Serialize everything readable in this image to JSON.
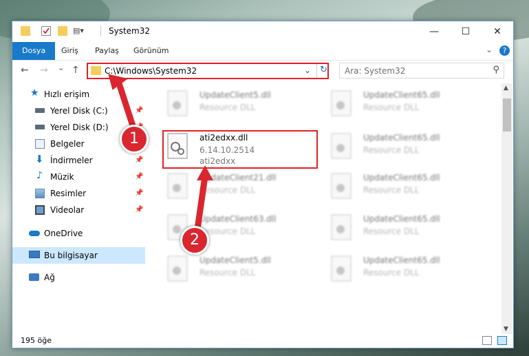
{
  "window": {
    "title": "System32",
    "controls": {
      "minimize": "—",
      "maximize": "☐",
      "close": "✕"
    }
  },
  "ribbon": {
    "tabs": [
      "Dosya",
      "Giriş",
      "Paylaş",
      "Görünüm"
    ],
    "active_tab": "Dosya",
    "expand_icon": "chevron-down-icon",
    "help_icon": "help-icon"
  },
  "navigation": {
    "back": "←",
    "forward": "→",
    "recent": "⌄",
    "up": "↑",
    "address": "C:\\Windows\\System32",
    "dropdown": "⌄",
    "refresh": "↻",
    "search_placeholder": "Ara: System32",
    "search_icon_glyph": "⚲"
  },
  "sidebar": {
    "items": [
      {
        "label": "Hızlı erişim",
        "icon": "star-icon",
        "pinned": false
      },
      {
        "label": "Yerel Disk (C:)",
        "icon": "drive-icon",
        "pinned": true
      },
      {
        "label": "Yerel Disk (D:)",
        "icon": "drive-icon",
        "pinned": true
      },
      {
        "label": "Belgeler",
        "icon": "documents-icon",
        "pinned": true
      },
      {
        "label": "İndirmeler",
        "icon": "download-icon",
        "pinned": true
      },
      {
        "label": "Müzik",
        "icon": "music-icon",
        "pinned": true
      },
      {
        "label": "Resimler",
        "icon": "pictures-icon",
        "pinned": true
      },
      {
        "label": "Videolar",
        "icon": "videos-icon",
        "pinned": true
      },
      {
        "label": "OneDrive",
        "icon": "cloud-icon",
        "pinned": false
      },
      {
        "label": "Bu bilgisayar",
        "icon": "computer-icon",
        "pinned": false,
        "selected": true
      },
      {
        "label": "Ağ",
        "icon": "network-icon",
        "pinned": false
      }
    ],
    "pin_glyph": "📌"
  },
  "files": {
    "highlighted": {
      "name": "ati2edxx.dll",
      "version": "6.14.10.2514",
      "desc": "ati2edxx"
    },
    "blurred": [
      {
        "name": "UpdateClient5.dll",
        "desc": "Resource DLL"
      },
      {
        "name": "UpdateClient65.dll",
        "desc": "Resource DLL"
      },
      {
        "name": "UpdateClient65.dll",
        "desc": "Resource DLL"
      },
      {
        "name": "UpdateClient21.dll",
        "desc": "Resource DLL"
      },
      {
        "name": "UpdateClient65.dll",
        "desc": "Resource DLL"
      },
      {
        "name": "UpdateClient63.dll",
        "desc": "Resource DLL"
      },
      {
        "name": "UpdateClient65.dll",
        "desc": "Resource DLL"
      },
      {
        "name": "UpdateClient5.dll",
        "desc": "Resource DLL"
      },
      {
        "name": "UpdateClient65.dll",
        "desc": "Resource DLL"
      }
    ]
  },
  "status": {
    "item_count": "195 öğe"
  },
  "callouts": {
    "one": "1",
    "two": "2"
  },
  "colors": {
    "accent": "#1979ca",
    "highlight_red": "#e31f26",
    "selection": "#cce8ff"
  }
}
